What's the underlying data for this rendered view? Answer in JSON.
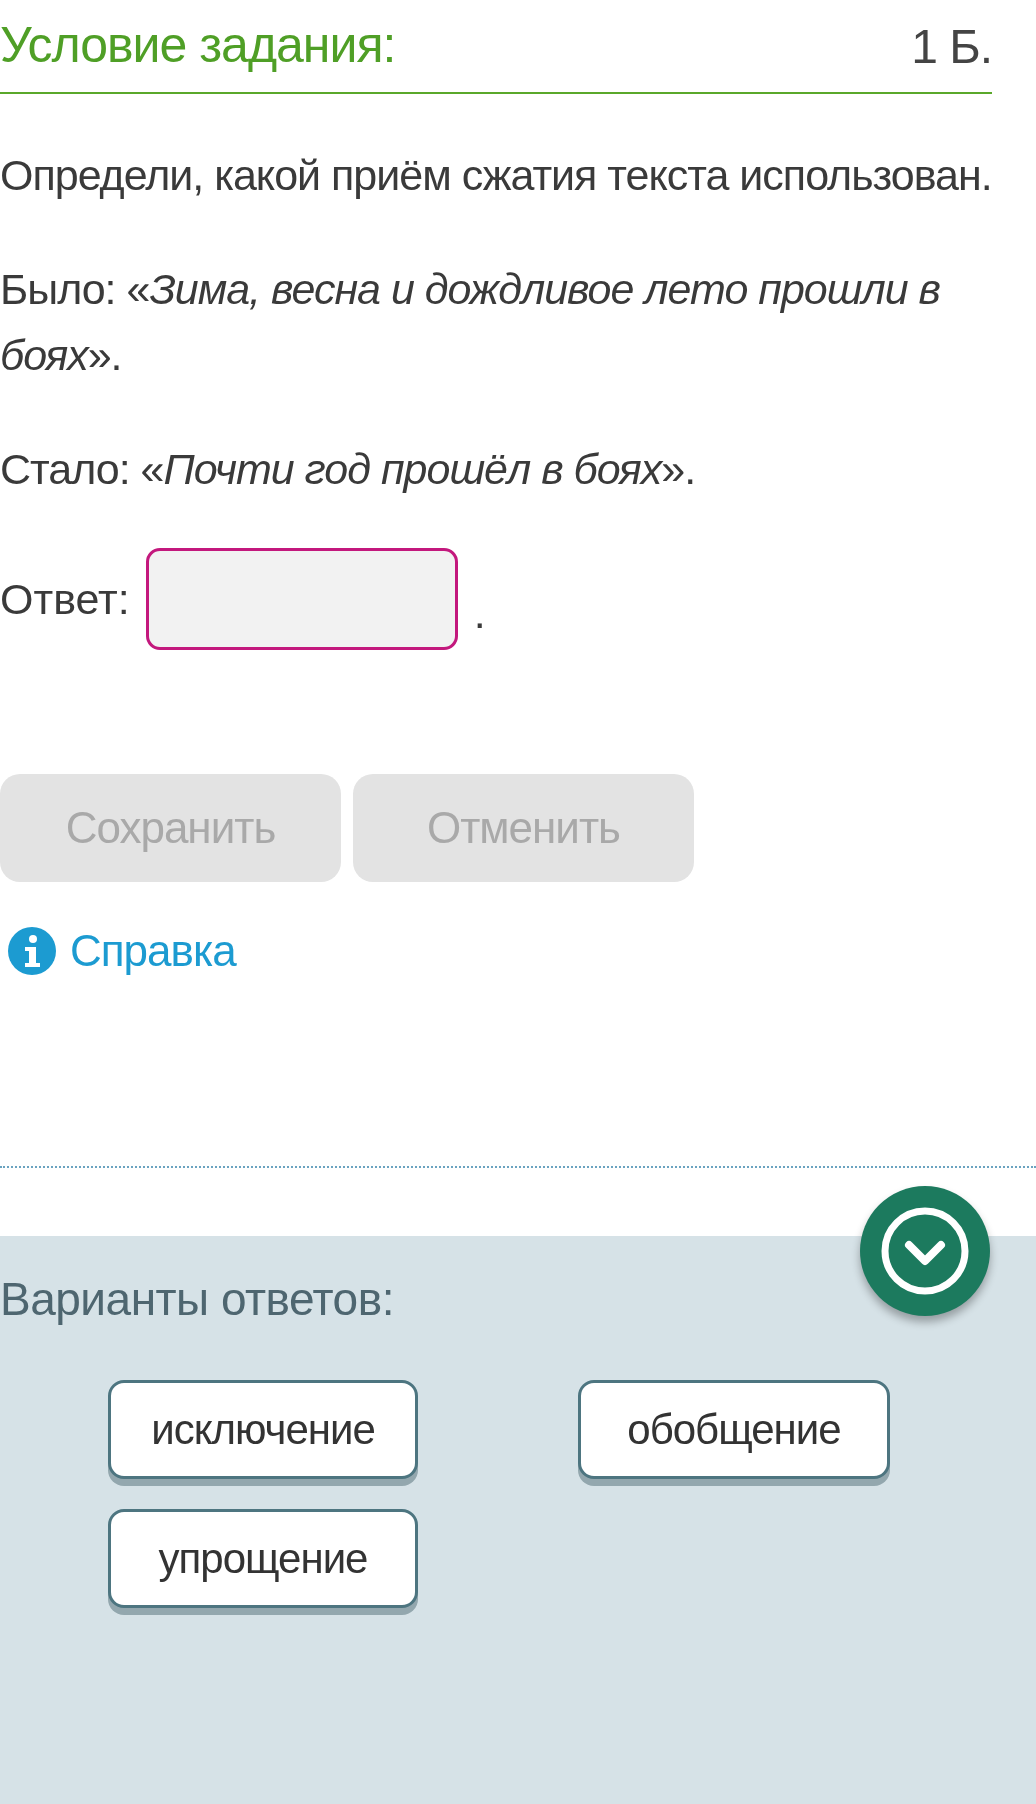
{
  "task": {
    "title": "Условие задания:",
    "points": "1 Б."
  },
  "paragraphs": [
    "Определи, какой приём сжатия текста использован.",
    "Было: «*Зима, весна и дождливое лето прошли в боях*».",
    "Стало: «*Почти год прошёл в боях*»."
  ],
  "answer": {
    "label": "Ответ:",
    "suffix": "."
  },
  "buttons": [
    {
      "label": "Сохранить",
      "disabled": true
    },
    {
      "label": "Отменить",
      "disabled": true
    }
  ],
  "help": {
    "label": "Справка"
  },
  "options": {
    "title": "Варианты ответов:",
    "items": [
      "исключение",
      "обобщение",
      "упрощение"
    ]
  }
}
